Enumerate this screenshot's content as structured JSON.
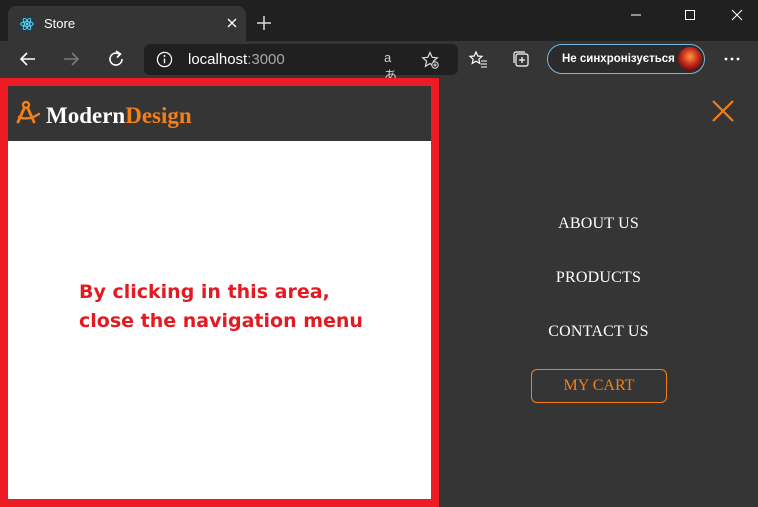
{
  "browser": {
    "tab_title": "Store",
    "url_host": "localhost",
    "url_port": ":3000",
    "profile_label": "Не синхронізується",
    "read_aloud_glyph": "aあ"
  },
  "site": {
    "logo_part1": "Modern",
    "logo_part2": "Design",
    "hint_line1": "By clicking in this area,",
    "hint_line2": "close the navigation menu",
    "menu": {
      "about": "ABOUT US",
      "products": "PRODUCTS",
      "contact": "CONTACT US",
      "cart": "MY CART"
    }
  },
  "colors": {
    "accent": "#f57f17",
    "highlight_border": "#ed1c24",
    "nav_bg": "#353535"
  }
}
